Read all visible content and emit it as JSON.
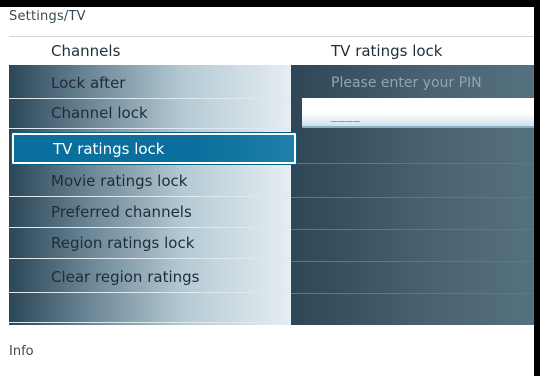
{
  "breadcrumb": "Settings/TV",
  "left": {
    "header": "Channels",
    "items": [
      {
        "label": "Lock after"
      },
      {
        "label": "Channel lock"
      },
      {
        "label": "TV ratings lock"
      },
      {
        "label": "Movie ratings lock"
      },
      {
        "label": "Preferred channels"
      },
      {
        "label": "Region ratings lock"
      },
      {
        "label": "Clear region ratings"
      }
    ],
    "selected_index": 2
  },
  "right": {
    "header": "TV ratings lock",
    "prompt": "Please enter your PIN",
    "pin_value": "____"
  },
  "footer": {
    "info": "Info"
  },
  "colors": {
    "selection": "#0b6f9d",
    "frame": "#000000"
  }
}
